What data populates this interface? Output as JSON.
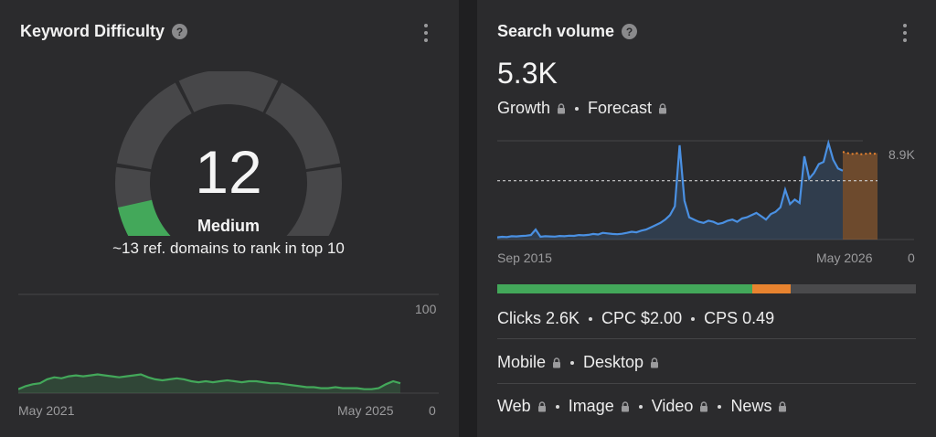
{
  "keyword_difficulty": {
    "title": "Keyword Difficulty",
    "help_icon": "question-circle-icon",
    "value": "12",
    "score": 12,
    "level": "Medium",
    "description": "~13 ref. domains to rank in top 10",
    "trend": {
      "y_max_label": "100",
      "y_min_label": "0",
      "x_start_label": "May 2021",
      "x_end_label": "May 2025",
      "values": [
        4,
        7,
        9,
        10,
        14,
        16,
        15,
        17,
        18,
        17,
        18,
        19,
        18,
        17,
        16,
        17,
        18,
        19,
        16,
        14,
        13,
        14,
        15,
        14,
        12,
        11,
        12,
        11,
        12,
        13,
        12,
        11,
        12,
        12,
        11,
        10,
        10,
        9,
        8,
        7,
        6,
        6,
        5,
        5,
        6,
        5,
        5,
        5,
        4,
        4,
        5,
        9,
        12,
        10
      ]
    },
    "color_gauge": "#43a85a"
  },
  "search_volume": {
    "title": "Search volume",
    "help_icon": "question-circle-icon",
    "value": "5.3K",
    "tabs": [
      {
        "label": "Growth",
        "locked": true
      },
      {
        "label": "Forecast",
        "locked": true
      }
    ],
    "chart": {
      "y_max_label": "8.9K",
      "y_min_label": "0",
      "x_start_label": "Sep 2015",
      "x_end_label": "May 2026",
      "values": [
        200,
        250,
        220,
        300,
        280,
        320,
        350,
        400,
        900,
        250,
        300,
        280,
        260,
        320,
        300,
        350,
        330,
        400,
        380,
        420,
        500,
        450,
        600,
        550,
        500,
        480,
        520,
        600,
        700,
        650,
        800,
        900,
        1100,
        1300,
        1500,
        1800,
        2200,
        3000,
        8500,
        3500,
        2000,
        1800,
        1600,
        1500,
        1700,
        1600,
        1400,
        1500,
        1700,
        1800,
        1600,
        1900,
        2000,
        2200,
        2400,
        2100,
        1800,
        2300,
        2500,
        2900,
        4500,
        3200,
        3600,
        3300,
        7500,
        5500,
        6000,
        6800,
        7000,
        8700,
        7200,
        6400,
        6200
      ],
      "forecast_values": [
        7900,
        7800,
        7700,
        7800,
        7700,
        7700,
        7800,
        7700,
        7800
      ],
      "average_label_value": 5300
    },
    "metrics": {
      "clicks": "Clicks 2.6K",
      "cpc": "CPC $2.00",
      "cps": "CPS 0.49",
      "organic_share": 0.61,
      "paid_share": 0.09
    },
    "devices": [
      {
        "label": "Mobile",
        "locked": true
      },
      {
        "label": "Desktop",
        "locked": true
      }
    ],
    "search_types": [
      {
        "label": "Web",
        "locked": true
      },
      {
        "label": "Image",
        "locked": true
      },
      {
        "label": "Video",
        "locked": true
      },
      {
        "label": "News",
        "locked": true
      }
    ],
    "colors": {
      "line": "#4a90e2",
      "forecast": "#e8832f",
      "organic": "#43a85a",
      "paid": "#e8832f"
    }
  }
}
